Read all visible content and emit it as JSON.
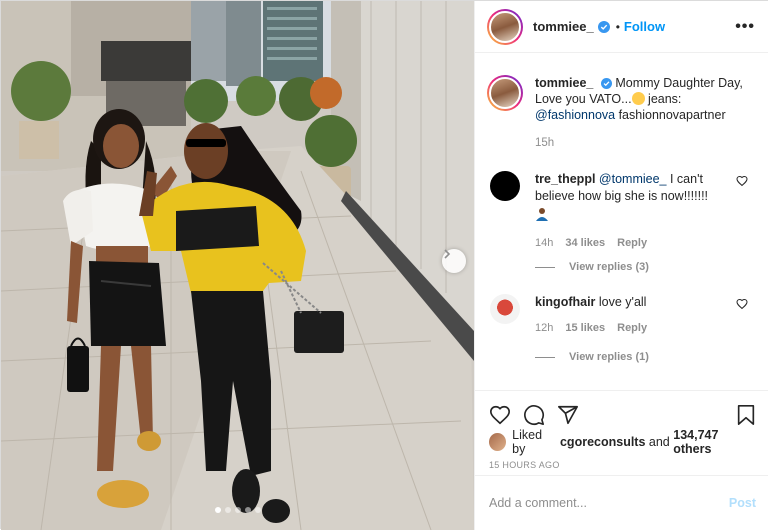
{
  "post": {
    "author": "tommiee_",
    "verified": true,
    "follow_label": "Follow",
    "separator": "•",
    "more_label": "•••"
  },
  "caption": {
    "username": "tommiee_",
    "text_1": "Mommy Daughter Day, Love you VATO...",
    "text_2": " jeans: ",
    "mention": "@fashionnova",
    "text_3": " fashionnovapartner",
    "time": "15h"
  },
  "comments": [
    {
      "username": "tre_theppl",
      "mention": "@tommiee_",
      "text": " I can't believe how big she is now!!!!!!!",
      "time": "14h",
      "likes": "34 likes",
      "reply_label": "Reply",
      "view_replies": "View replies (3)"
    },
    {
      "username": "kingofhair",
      "text": "love y'all",
      "time": "12h",
      "likes": "15 likes",
      "reply_label": "Reply",
      "view_replies": "View replies (1)"
    }
  ],
  "likes": {
    "prefix": "Liked by ",
    "user": "cgoreconsults",
    "middle": " and ",
    "others": "134,747 others"
  },
  "posted_ago": "15 HOURS AGO",
  "add_comment": {
    "placeholder": "Add a comment...",
    "post_label": "Post"
  },
  "carousel": {
    "count": 5,
    "active_index": 0
  },
  "icons": [
    "heart-icon",
    "comment-icon",
    "share-icon",
    "bookmark-icon",
    "chevron-right-icon",
    "verified-badge-icon",
    "more-icon"
  ],
  "colors": {
    "link": "#0095f6",
    "mention": "#00376b",
    "muted": "#8e8e8e",
    "post_disabled": "#b2dffc"
  }
}
